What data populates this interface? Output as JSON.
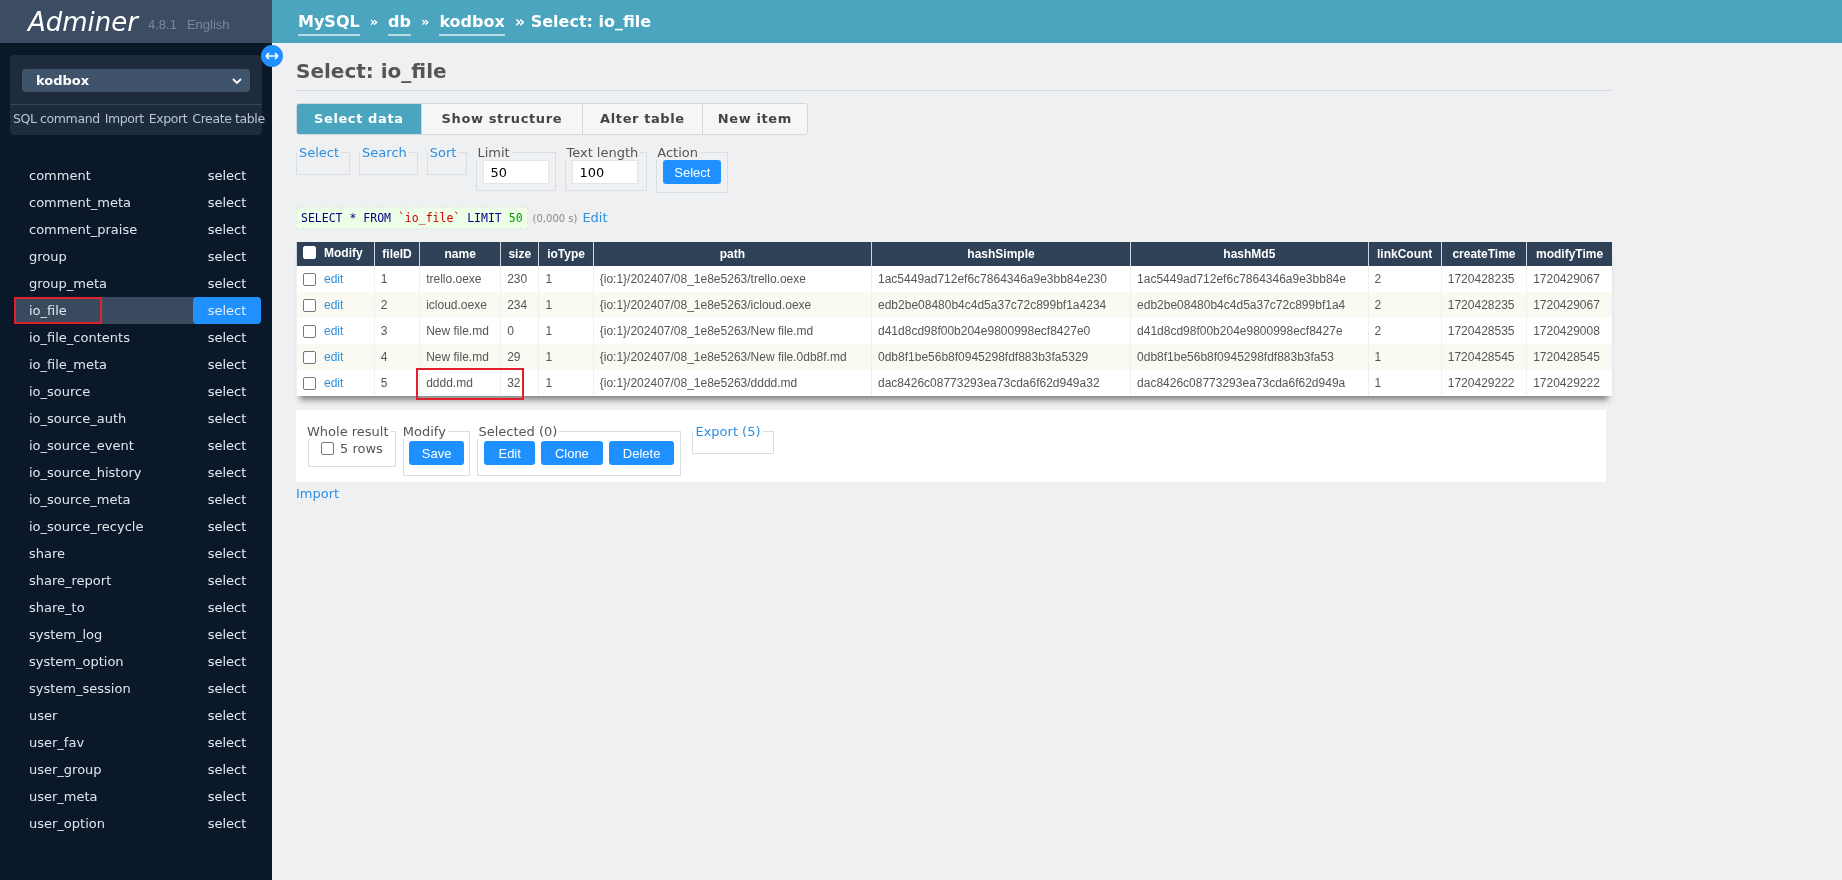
{
  "app": {
    "name": "Adminer",
    "version": "4.8.1",
    "language": "English"
  },
  "sidebar": {
    "database": "kodbox",
    "links": [
      "SQL command",
      "Import",
      "Export",
      "Create table"
    ],
    "tables": [
      {
        "name": "comment",
        "action": "select",
        "selected": false
      },
      {
        "name": "comment_meta",
        "action": "select",
        "selected": false
      },
      {
        "name": "comment_praise",
        "action": "select",
        "selected": false
      },
      {
        "name": "group",
        "action": "select",
        "selected": false
      },
      {
        "name": "group_meta",
        "action": "select",
        "selected": false
      },
      {
        "name": "io_file",
        "action": "select",
        "selected": true,
        "marked": true
      },
      {
        "name": "io_file_contents",
        "action": "select",
        "selected": false
      },
      {
        "name": "io_file_meta",
        "action": "select",
        "selected": false
      },
      {
        "name": "io_source",
        "action": "select",
        "selected": false
      },
      {
        "name": "io_source_auth",
        "action": "select",
        "selected": false
      },
      {
        "name": "io_source_event",
        "action": "select",
        "selected": false
      },
      {
        "name": "io_source_history",
        "action": "select",
        "selected": false
      },
      {
        "name": "io_source_meta",
        "action": "select",
        "selected": false
      },
      {
        "name": "io_source_recycle",
        "action": "select",
        "selected": false
      },
      {
        "name": "share",
        "action": "select",
        "selected": false
      },
      {
        "name": "share_report",
        "action": "select",
        "selected": false
      },
      {
        "name": "share_to",
        "action": "select",
        "selected": false
      },
      {
        "name": "system_log",
        "action": "select",
        "selected": false
      },
      {
        "name": "system_option",
        "action": "select",
        "selected": false
      },
      {
        "name": "system_session",
        "action": "select",
        "selected": false
      },
      {
        "name": "user",
        "action": "select",
        "selected": false
      },
      {
        "name": "user_fav",
        "action": "select",
        "selected": false
      },
      {
        "name": "user_group",
        "action": "select",
        "selected": false
      },
      {
        "name": "user_meta",
        "action": "select",
        "selected": false
      },
      {
        "name": "user_option",
        "action": "select",
        "selected": false
      }
    ]
  },
  "breadcrumb": [
    {
      "kind": "link",
      "text": "MySQL"
    },
    {
      "kind": "separator",
      "text": "»"
    },
    {
      "kind": "link",
      "text": "db"
    },
    {
      "kind": "separator",
      "text": "»"
    },
    {
      "kind": "link",
      "text": "kodbox"
    },
    {
      "kind": "current",
      "text": "» Select: io_file"
    }
  ],
  "title": "Select: io_file",
  "tabs": [
    {
      "label": "Select data",
      "selected": true
    },
    {
      "label": "Show structure",
      "selected": false
    },
    {
      "label": "Alter table",
      "selected": false
    },
    {
      "label": "New item",
      "selected": false
    }
  ],
  "filters": [
    {
      "kind": "link",
      "legend": "Select"
    },
    {
      "kind": "link",
      "legend": "Search"
    },
    {
      "kind": "link",
      "legend": "Sort"
    },
    {
      "kind": "input",
      "legend": "Limit",
      "value": "50"
    },
    {
      "kind": "input",
      "legend": "Text length",
      "value": "100"
    },
    {
      "kind": "button",
      "legend": "Action",
      "button": "Select"
    }
  ],
  "query": {
    "parts": [
      {
        "kind": "keyword",
        "text": "SELECT * FROM "
      },
      {
        "kind": "string",
        "text": "`io_file`"
      },
      {
        "kind": "keyword",
        "text": " LIMIT "
      },
      {
        "kind": "number",
        "text": "50"
      }
    ],
    "time": "(0,000 s)",
    "edit": "Edit"
  },
  "table": {
    "columns": [
      "Modify",
      "fileID",
      "name",
      "size",
      "ioType",
      "path",
      "hashSimple",
      "hashMd5",
      "linkCount",
      "createTime",
      "modifyTime"
    ],
    "select_all_checked": false,
    "rows": [
      {
        "checked": false,
        "marked": false,
        "cells": [
          "edit",
          "1",
          "trello.oexe",
          "230",
          "1",
          "{io:1}/202407/08_1e8e5263/trello.oexe",
          "1ac5449ad712ef6c7864346a9e3bb84e230",
          "1ac5449ad712ef6c7864346a9e3bb84e",
          "2",
          "1720428235",
          "1720429067"
        ]
      },
      {
        "checked": false,
        "marked": false,
        "cells": [
          "edit",
          "2",
          "icloud.oexe",
          "234",
          "1",
          "{io:1}/202407/08_1e8e5263/icloud.oexe",
          "edb2be08480b4c4d5a37c72c899bf1a4234",
          "edb2be08480b4c4d5a37c72c899bf1a4",
          "2",
          "1720428235",
          "1720429067"
        ]
      },
      {
        "checked": false,
        "marked": false,
        "cells": [
          "edit",
          "3",
          "New file.md",
          "0",
          "1",
          "{io:1}/202407/08_1e8e5263/New file.md",
          "d41d8cd98f00b204e9800998ecf8427e0",
          "d41d8cd98f00b204e9800998ecf8427e",
          "2",
          "1720428535",
          "1720429008"
        ]
      },
      {
        "checked": false,
        "marked": false,
        "cells": [
          "edit",
          "4",
          "New file.md",
          "29",
          "1",
          "{io:1}/202407/08_1e8e5263/New file.0db8f.md",
          "0db8f1be56b8f0945298fdf883b3fa5329",
          "0db8f1be56b8f0945298fdf883b3fa53",
          "1",
          "1720428545",
          "1720428545"
        ]
      },
      {
        "checked": false,
        "marked": true,
        "cells": [
          "edit",
          "5",
          "dddd.md",
          "32",
          "1",
          "{io:1}/202407/08_1e8e5263/dddd.md",
          "dac8426c08773293ea73cda6f62d949a32",
          "dac8426c08773293ea73cda6f62d949a",
          "1",
          "1720429222",
          "1720429222"
        ]
      }
    ]
  },
  "actions": {
    "whole_result": {
      "legend": "Whole result",
      "label": "5 rows",
      "checked": false
    },
    "modify": {
      "legend": "Modify",
      "button": "Save"
    },
    "selected": {
      "legend": "Selected (0)",
      "buttons": [
        "Edit",
        "Clone",
        "Delete"
      ]
    },
    "export": "Export (5)"
  },
  "import": "Import"
}
